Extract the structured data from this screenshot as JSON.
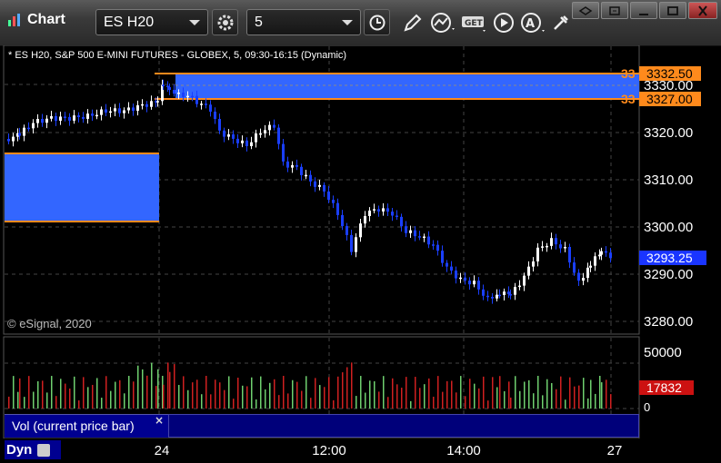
{
  "toolbar": {
    "title": "Chart",
    "symbol": "ES H20",
    "interval": "5",
    "icons": [
      "settings-gear-icon",
      "clock-icon",
      "pencil-icon",
      "chart-line-icon",
      "get-icon",
      "play-icon",
      "alert-icon",
      "tools-icon"
    ]
  },
  "window_buttons": [
    "link-icon",
    "restore-icon",
    "maximize-icon",
    "close-icon"
  ],
  "chart": {
    "legend": "* ES H20, S&P 500 E-MINI FUTURES - GLOBEX, 5, 09:30-16:15 (Dynamic)",
    "copyright": "© eSignal, 2020",
    "price_axis": [
      "3330.00",
      "3320.00",
      "3310.00",
      "3300.00",
      "3290.00",
      "3280.00"
    ],
    "current_price": "3293.25",
    "order_tags": [
      {
        "num": "33",
        "price": "3332.50"
      },
      {
        "num": "33",
        "price": "3327.00"
      }
    ],
    "x_axis": [
      "24",
      "12:00",
      "14:00",
      "27"
    ],
    "volume_axis": [
      "50000",
      "0"
    ],
    "volume_current": "17832",
    "volume_panel_label": "Vol (current price bar)",
    "close_x": "×",
    "dyn_label": "Dyn"
  },
  "colors": {
    "up": "#ffffff",
    "down": "#1a3fff",
    "zone": "#3366ff",
    "order_line": "#ff8a1c",
    "vol_up": "#6fd06f",
    "vol_down": "#d02020",
    "price_tag": "#1a35ff",
    "vol_tag": "#cc1111"
  }
}
